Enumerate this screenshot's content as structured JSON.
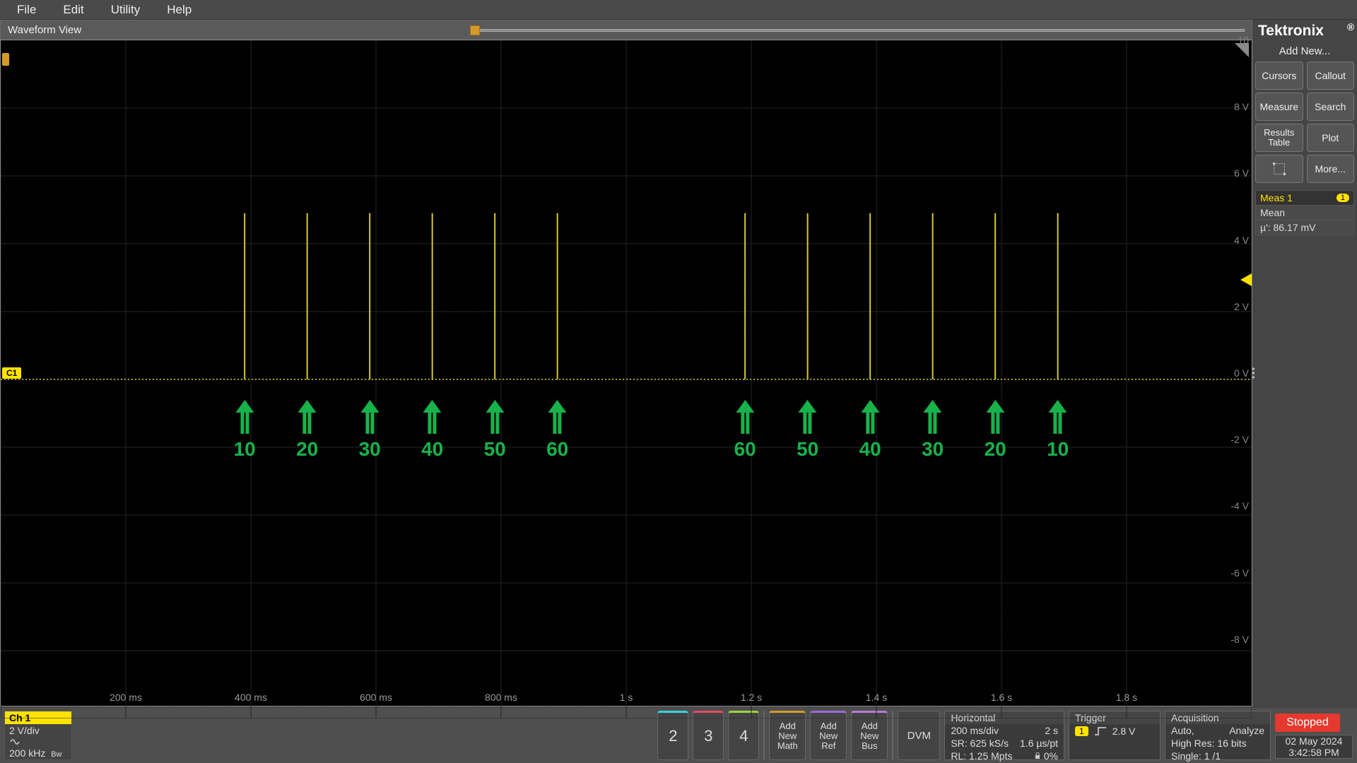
{
  "menu": {
    "file": "File",
    "edit": "Edit",
    "utility": "Utility",
    "help": "Help"
  },
  "waveform": {
    "title": "Waveform View",
    "channel_badge": "C1",
    "zero_v": "0 V",
    "y_labels": [
      {
        "v": "10",
        "t": 0.0
      },
      {
        "v": "8 V",
        "t": 0.1
      },
      {
        "v": "6 V",
        "t": 0.2
      },
      {
        "v": "4 V",
        "t": 0.3
      },
      {
        "v": "2 V",
        "t": 0.4
      },
      {
        "v": "-2 V",
        "t": 0.6
      },
      {
        "v": "-4 V",
        "t": 0.7
      },
      {
        "v": "-6 V",
        "t": 0.8
      },
      {
        "v": "-8 V",
        "t": 0.9
      }
    ],
    "x_labels": [
      {
        "v": "200 ms",
        "t": 0.1
      },
      {
        "v": "400 ms",
        "t": 0.2
      },
      {
        "v": "600 ms",
        "t": 0.3
      },
      {
        "v": "800 ms",
        "t": 0.4
      },
      {
        "v": "1 s",
        "t": 0.5
      },
      {
        "v": "1.2 s",
        "t": 0.6
      },
      {
        "v": "1.4 s",
        "t": 0.7
      },
      {
        "v": "1.6 s",
        "t": 0.8
      },
      {
        "v": "1.8 s",
        "t": 0.9
      }
    ],
    "trigger_y_frac": 0.36,
    "pulses": [
      0.195,
      0.245,
      0.295,
      0.345,
      0.395,
      0.445,
      0.595,
      0.645,
      0.695,
      0.745,
      0.795,
      0.845
    ],
    "annotations": [
      {
        "x": 0.195,
        "lbl": "10"
      },
      {
        "x": 0.245,
        "lbl": "20"
      },
      {
        "x": 0.295,
        "lbl": "30"
      },
      {
        "x": 0.345,
        "lbl": "40"
      },
      {
        "x": 0.395,
        "lbl": "50"
      },
      {
        "x": 0.445,
        "lbl": "60"
      },
      {
        "x": 0.595,
        "lbl": "60"
      },
      {
        "x": 0.645,
        "lbl": "50"
      },
      {
        "x": 0.695,
        "lbl": "40"
      },
      {
        "x": 0.745,
        "lbl": "30"
      },
      {
        "x": 0.795,
        "lbl": "20"
      },
      {
        "x": 0.845,
        "lbl": "10"
      }
    ]
  },
  "right_panel": {
    "brand": "Tektronix",
    "add_new": "Add New...",
    "cursors": "Cursors",
    "callout": "Callout",
    "measure": "Measure",
    "search": "Search",
    "results_table": "Results\nTable",
    "plot": "Plot",
    "more": "More...",
    "meas": {
      "title": "Meas 1",
      "tag": "1",
      "row1": "Mean",
      "row2": "µ': 86.17 mV"
    }
  },
  "bottom": {
    "ch": {
      "name": "Ch 1",
      "scale": "2 V/div",
      "bw": "200 kHz"
    },
    "chs": [
      "2",
      "3",
      "4"
    ],
    "math": {
      "l1": "Add",
      "l2": "New",
      "l3": "Math"
    },
    "ref": {
      "l1": "Add",
      "l2": "New",
      "l3": "Ref"
    },
    "bus": {
      "l1": "Add",
      "l2": "New",
      "l3": "Bus"
    },
    "dvm": "DVM",
    "horiz": {
      "title": "Horizontal",
      "r1a": "200 ms/div",
      "r1b": "2 s",
      "r2a": "SR: 625 kS/s",
      "r2b": "1.6 µs/pt",
      "r3a": "RL: 1.25 Mpts",
      "r3b": "0%"
    },
    "trig": {
      "title": "Trigger",
      "tag": "1",
      "level": "2.8 V"
    },
    "acq": {
      "title": "Acquisition",
      "r1a": "Auto,",
      "r1b": "Analyze",
      "r2": "High Res: 16 bits",
      "r3": "Single: 1 /1"
    },
    "status": "Stopped",
    "date": "02 May 2024",
    "time": "3:42:58 PM"
  }
}
